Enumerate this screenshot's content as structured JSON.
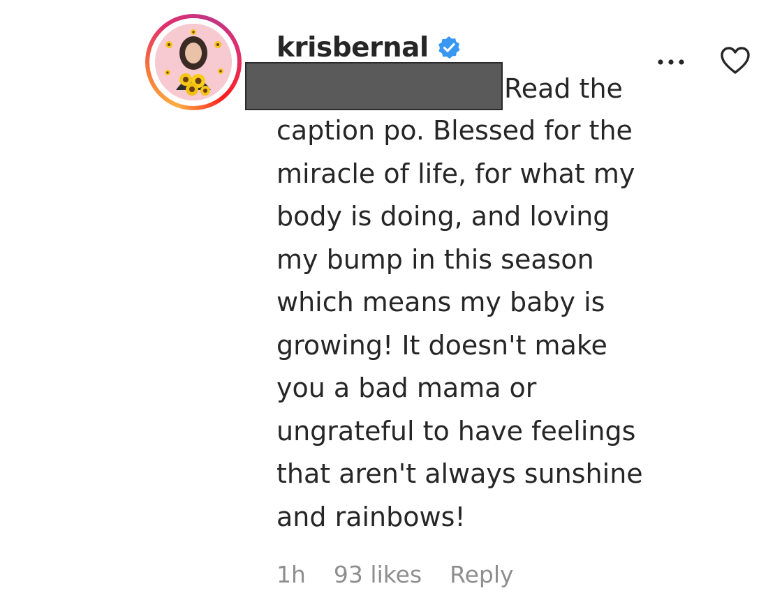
{
  "comment": {
    "username": "krisbernal",
    "verified_icon": "verified-badge-icon",
    "first_line_text": "Read the",
    "body_lines": [
      "caption po. Blessed for the",
      "miracle of life, for what my",
      "body is doing, and loving",
      "my bump in this season",
      "which means my baby is",
      "growing! It doesn't make",
      "you a bad mama or",
      "ungrateful to have feelings",
      "that aren't always sunshine",
      "and rainbows!"
    ],
    "meta": {
      "time": "1h",
      "likes": "93 likes",
      "reply_label": "Reply"
    },
    "actions": {
      "more_icon": "more-options-icon",
      "like_icon": "heart-icon"
    }
  },
  "colors": {
    "text": "#262626",
    "muted": "#8e8e8e",
    "verified_blue": "#3897f0",
    "redaction": "#5a5a5a"
  }
}
